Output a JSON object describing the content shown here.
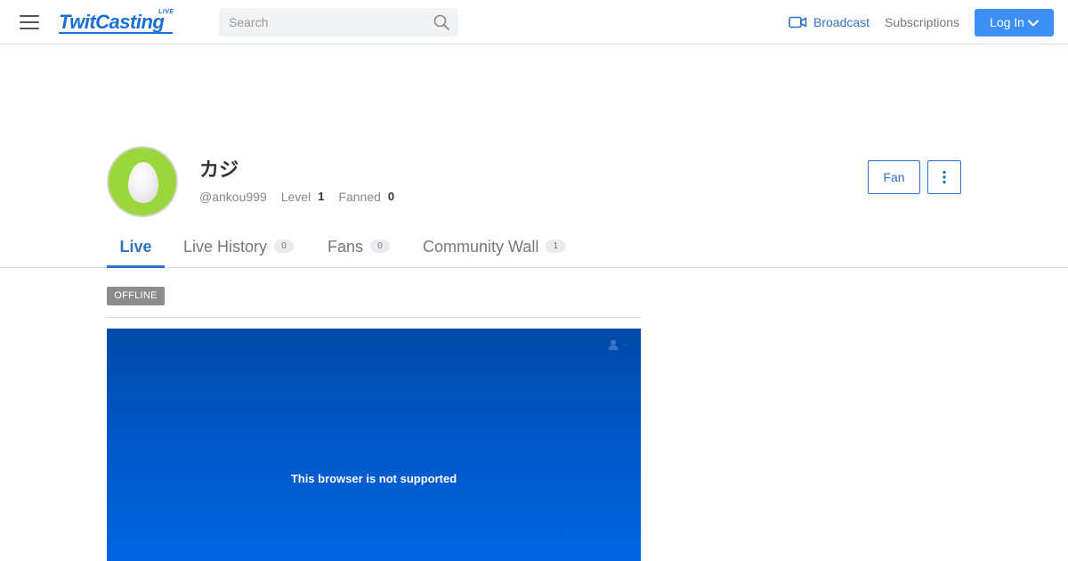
{
  "header": {
    "logo": "TwitCasting",
    "logo_badge": "LIVE",
    "search_placeholder": "Search",
    "broadcast_label": "Broadcast",
    "subscriptions_label": "Subscriptions",
    "login_label": "Log In"
  },
  "profile": {
    "name": "カジ",
    "handle": "@ankou999",
    "level_label": "Level",
    "level_value": "1",
    "fanned_label": "Fanned",
    "fanned_value": "0",
    "fan_button": "Fan"
  },
  "tabs": [
    {
      "label": "Live",
      "active": true
    },
    {
      "label": "Live History",
      "count": "0"
    },
    {
      "label": "Fans",
      "count": "0"
    },
    {
      "label": "Community Wall",
      "count": "1"
    }
  ],
  "stream": {
    "status": "OFFLINE",
    "viewer_count": "-",
    "message": "This browser is not supported"
  },
  "colors": {
    "accent": "#2c72c7",
    "login_bg": "#3e8ef7",
    "avatar_bg": "#9ad63c",
    "player_top": "#004aa8",
    "player_bottom": "#0066e0"
  }
}
